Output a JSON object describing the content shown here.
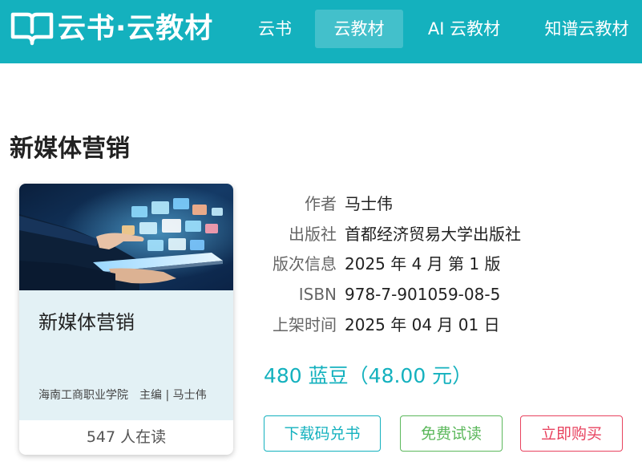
{
  "header": {
    "logo_text": "云书·云教材",
    "nav": [
      {
        "label": "云书",
        "active": false
      },
      {
        "label": "云教材",
        "active": true
      },
      {
        "label": "AI 云教材",
        "active": false
      },
      {
        "label": "知谱云教材",
        "active": false
      }
    ]
  },
  "book": {
    "title": "新媒体营销",
    "card": {
      "title": "新媒体营销",
      "publisher_short": "海南工商职业学院",
      "editor": "主编 | 马士伟",
      "readers": "547 人在读"
    },
    "info": [
      {
        "label": "作者",
        "value": "马士伟"
      },
      {
        "label": "出版社",
        "value": "首都经济贸易大学出版社"
      },
      {
        "label": "版次信息",
        "value": "2025 年 4 月 第 1 版"
      },
      {
        "label": "ISBN",
        "value": "978-7-901059-08-5"
      },
      {
        "label": "上架时间",
        "value": "2025 年 04 月 01 日"
      }
    ],
    "price": "480 蓝豆（48.00 元）"
  },
  "actions": {
    "download": "下载码兑书",
    "trial": "免费试读",
    "buy": "立即购买"
  },
  "colors": {
    "brand": "#14b1be",
    "trial": "#5cb85c",
    "buy": "#e8435f"
  }
}
